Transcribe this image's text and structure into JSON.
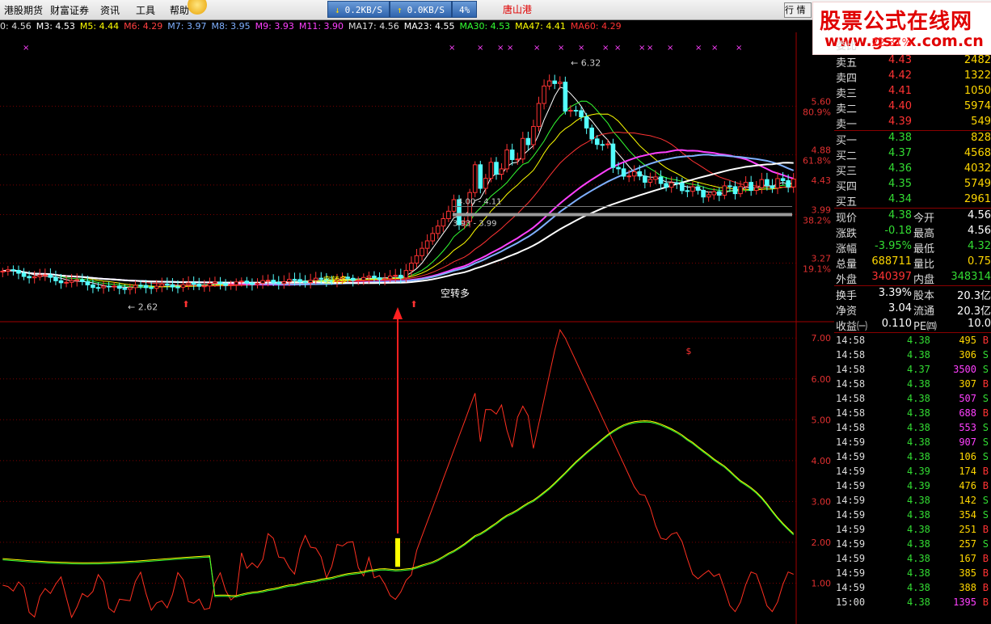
{
  "menu": [
    "港股期货",
    "财富证券",
    "资讯",
    "工具",
    "帮助"
  ],
  "net": {
    "down": "0.2KB/S",
    "up": "0.0KB/S",
    "pct": "4%"
  },
  "stock_name": "唐山港",
  "brand": {
    "line1": "股票公式在线网",
    "line2": "www.gsz x.com.cn"
  },
  "hang_btn": "行 情",
  "ma_legend": [
    {
      "text": "0: 4.56",
      "color": "#dddddd"
    },
    {
      "text": "M3: 4.53",
      "color": "#ffffff"
    },
    {
      "text": "M5: 4.44",
      "color": "#ffff00"
    },
    {
      "text": "M6: 4.29",
      "color": "#ff4040"
    },
    {
      "text": "M7: 3.97",
      "color": "#7fb0ff"
    },
    {
      "text": "M8: 3.95",
      "color": "#7fb0ff"
    },
    {
      "text": "M9: 3.93",
      "color": "#ff40ff"
    },
    {
      "text": "M11: 3.90",
      "color": "#ff40ff"
    },
    {
      "text": "MA17: 4.56",
      "color": "#dddddd"
    },
    {
      "text": "MA23: 4.55",
      "color": "#ffffff"
    },
    {
      "text": "MA30: 4.53",
      "color": "#33ff33"
    },
    {
      "text": "MA47: 4.41",
      "color": "#ffff00"
    },
    {
      "text": "MA60: 4.29",
      "color": "#ff3333"
    }
  ],
  "price_axis": [
    {
      "label": "5.60",
      "pct": "80.9%"
    },
    {
      "label": "4.88",
      "pct": "61.8%"
    },
    {
      "label": "4.43",
      "pct": ""
    },
    {
      "label": "3.99",
      "pct": "38.2%"
    },
    {
      "label": "3.27",
      "pct": "19.1%"
    }
  ],
  "ind_axis": [
    "7.00",
    "6.00",
    "5.00",
    "4.00",
    "3.00",
    "2.00",
    "1.00"
  ],
  "annotations": {
    "high": "6.32",
    "low": "2.62",
    "range": "3.93 - 3.99",
    "range2": "4.00 - 4.11",
    "signal": "空转多",
    "signal_small": "空转多"
  },
  "chart_data": {
    "type": "candlestick",
    "price_ylim": [
      2.4,
      6.6
    ],
    "indicator_ylim": [
      0.0,
      7.4
    ],
    "high": 6.32,
    "low": 2.62,
    "last_close": 4.38
  },
  "quote": {
    "wb": {
      "label": "委比",
      "val": "22.31%",
      "label2": "委差",
      "val2": "6781"
    },
    "asks": [
      {
        "label": "卖五",
        "price": "4.43",
        "vol": "2482"
      },
      {
        "label": "卖四",
        "price": "4.42",
        "vol": "1322"
      },
      {
        "label": "卖三",
        "price": "4.41",
        "vol": "1050"
      },
      {
        "label": "卖二",
        "price": "4.40",
        "vol": "5974"
      },
      {
        "label": "卖一",
        "price": "4.39",
        "vol": "549"
      }
    ],
    "bids": [
      {
        "label": "买一",
        "price": "4.38",
        "vol": "828"
      },
      {
        "label": "买二",
        "price": "4.37",
        "vol": "4568"
      },
      {
        "label": "买三",
        "price": "4.36",
        "vol": "4032"
      },
      {
        "label": "买四",
        "price": "4.35",
        "vol": "5749"
      },
      {
        "label": "买五",
        "price": "4.34",
        "vol": "2961"
      }
    ],
    "stats": [
      {
        "l1": "现价",
        "v1": "4.38",
        "c1": "#33dd33",
        "l2": "今开",
        "v2": "4.56",
        "c2": "#ffffff"
      },
      {
        "l1": "涨跌",
        "v1": "-0.18",
        "c1": "#33dd33",
        "l2": "最高",
        "v2": "4.56",
        "c2": "#ffffff"
      },
      {
        "l1": "涨幅",
        "v1": "-3.95%",
        "c1": "#33dd33",
        "l2": "最低",
        "v2": "4.32",
        "c2": "#33dd33"
      },
      {
        "l1": "总量",
        "v1": "688711",
        "c1": "#ffd700",
        "l2": "量比",
        "v2": "0.75",
        "c2": "#ffd700"
      },
      {
        "l1": "外盘",
        "v1": "340397",
        "c1": "#ff3333",
        "l2": "内盘",
        "v2": "348314",
        "c2": "#33dd33"
      }
    ],
    "stats2": [
      {
        "l1": "换手",
        "v1": "3.39%",
        "l2": "股本",
        "v2": "20.3亿"
      },
      {
        "l1": "净资",
        "v1": "3.04",
        "l2": "流通",
        "v2": "20.3亿"
      },
      {
        "l1": "收益㈠",
        "v1": "0.110",
        "l2": "PE㈣",
        "v2": "10.0"
      }
    ]
  },
  "ticks": [
    {
      "t": "14:58",
      "p": "4.38",
      "v": "495",
      "s": "B"
    },
    {
      "t": "14:58",
      "p": "4.38",
      "v": "306",
      "s": "S"
    },
    {
      "t": "14:58",
      "p": "4.37",
      "v": "3500",
      "s": "S"
    },
    {
      "t": "14:58",
      "p": "4.38",
      "v": "307",
      "s": "B"
    },
    {
      "t": "14:58",
      "p": "4.38",
      "v": "507",
      "s": "S"
    },
    {
      "t": "14:58",
      "p": "4.38",
      "v": "688",
      "s": "B"
    },
    {
      "t": "14:58",
      "p": "4.38",
      "v": "553",
      "s": "S"
    },
    {
      "t": "14:59",
      "p": "4.38",
      "v": "907",
      "s": "S"
    },
    {
      "t": "14:59",
      "p": "4.38",
      "v": "106",
      "s": "S"
    },
    {
      "t": "14:59",
      "p": "4.39",
      "v": "174",
      "s": "B"
    },
    {
      "t": "14:59",
      "p": "4.39",
      "v": "476",
      "s": "B"
    },
    {
      "t": "14:59",
      "p": "4.38",
      "v": "142",
      "s": "S"
    },
    {
      "t": "14:59",
      "p": "4.38",
      "v": "354",
      "s": "S"
    },
    {
      "t": "14:59",
      "p": "4.38",
      "v": "251",
      "s": "B"
    },
    {
      "t": "14:59",
      "p": "4.38",
      "v": "257",
      "s": "S"
    },
    {
      "t": "14:59",
      "p": "4.38",
      "v": "167",
      "s": "B"
    },
    {
      "t": "14:59",
      "p": "4.38",
      "v": "385",
      "s": "B"
    },
    {
      "t": "14:59",
      "p": "4.38",
      "v": "388",
      "s": "B"
    },
    {
      "t": "15:00",
      "p": "4.38",
      "v": "1395",
      "s": "B"
    }
  ]
}
